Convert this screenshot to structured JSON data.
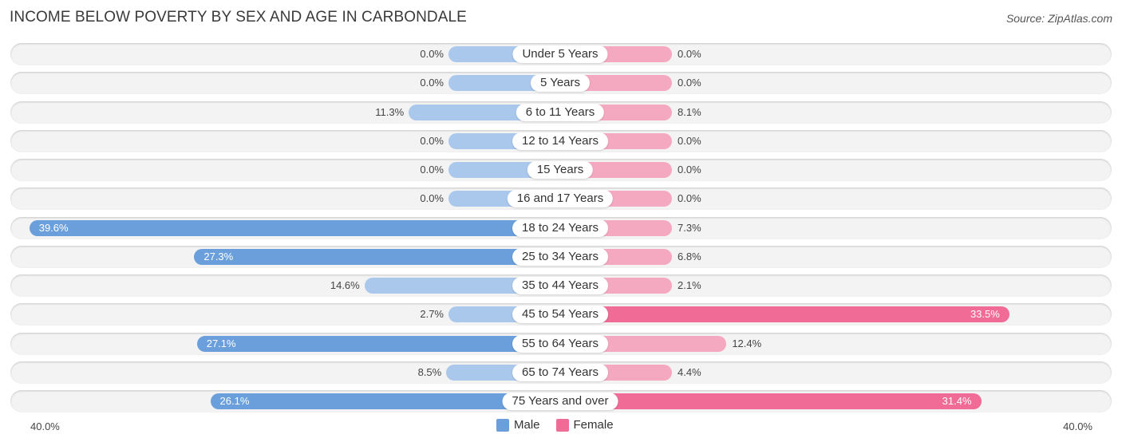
{
  "header": {
    "title": "INCOME BELOW POVERTY BY SEX AND AGE IN CARBONDALE",
    "source": "Source: ZipAtlas.com"
  },
  "chart_data": {
    "type": "bar",
    "orientation": "horizontal-diverging",
    "title": "INCOME BELOW POVERTY BY SEX AND AGE IN CARBONDALE",
    "categories": [
      "Under 5 Years",
      "5 Years",
      "6 to 11 Years",
      "12 to 14 Years",
      "15 Years",
      "16 and 17 Years",
      "18 to 24 Years",
      "25 to 34 Years",
      "35 to 44 Years",
      "45 to 54 Years",
      "55 to 64 Years",
      "65 to 74 Years",
      "75 Years and over"
    ],
    "series": [
      {
        "name": "Male",
        "color": "#6a9fdc",
        "light_color": "#a9c8ec",
        "values": [
          0.0,
          0.0,
          11.3,
          0.0,
          0.0,
          0.0,
          39.6,
          27.3,
          14.6,
          2.7,
          27.1,
          8.5,
          26.1
        ]
      },
      {
        "name": "Female",
        "color": "#f06b96",
        "light_color": "#f5a9c0",
        "values": [
          0.0,
          0.0,
          8.1,
          0.0,
          0.0,
          0.0,
          7.3,
          6.8,
          2.1,
          33.5,
          12.4,
          4.4,
          31.4
        ]
      }
    ],
    "value_labels": {
      "male": [
        "0.0%",
        "0.0%",
        "11.3%",
        "0.0%",
        "0.0%",
        "0.0%",
        "39.6%",
        "27.3%",
        "14.6%",
        "2.7%",
        "27.1%",
        "8.5%",
        "26.1%"
      ],
      "female": [
        "0.0%",
        "0.0%",
        "8.1%",
        "0.0%",
        "0.0%",
        "0.0%",
        "7.3%",
        "6.8%",
        "2.1%",
        "33.5%",
        "12.4%",
        "4.4%",
        "31.4%"
      ]
    },
    "xlim": [
      -40,
      40
    ],
    "axis_labels": {
      "left": "40.0%",
      "right": "40.0%"
    },
    "legend": {
      "position": "bottom-center",
      "entries": [
        "Male",
        "Female"
      ]
    }
  }
}
